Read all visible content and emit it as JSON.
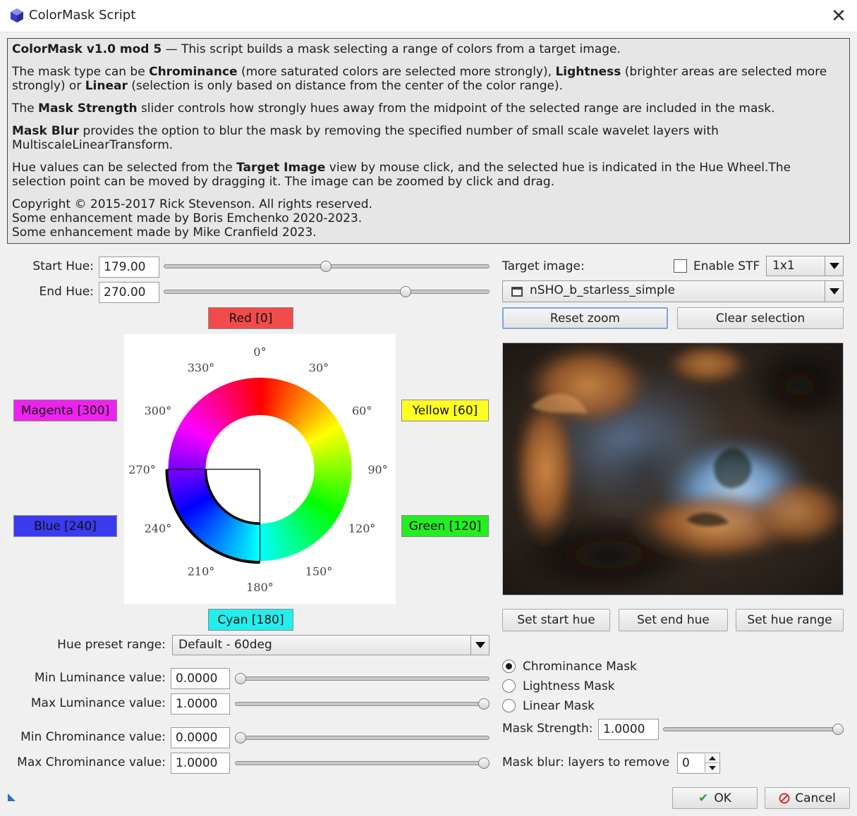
{
  "window": {
    "title": "ColorMask Script",
    "close_glyph": "✕"
  },
  "info": {
    "line1_bold": "ColorMask v1.0 mod 5",
    "line1_rest": " — This script builds a mask selecting a range of colors from a target image.",
    "p2_a": "The mask type can be ",
    "p2_b": "Chrominance",
    "p2_c": " (more saturated colors are selected more strongly), ",
    "p2_d": "Lightness",
    "p2_e": " (brighter areas are selected more strongly) or ",
    "p2_f": "Linear",
    "p2_g": " (selection is only based on distance from the center of the color range).",
    "p3_a": "The ",
    "p3_b": "Mask Strength",
    "p3_c": " slider controls how strongly hues away from the midpoint of the selected range are included in the mask.",
    "p4_b": "Mask Blur",
    "p4_c": " provides the option to blur the mask by removing the specified number of small scale wavelet layers with MultiscaleLinearTransform.",
    "p5_a": "Hue values can be selected from the ",
    "p5_b": "Target Image",
    "p5_c": " view by mouse click, and the selected hue is indicated in the Hue Wheel.The selection point can be moved by dragging it. The image can be zoomed by click and drag.",
    "copy1": "Copyright © 2015-2017 Rick Stevenson. All rights reserved.",
    "copy2": "Some enhancement made by Boris Emchenko 2020-2023.",
    "copy3": "Some enhancement made by Mike Cranfield 2023."
  },
  "hue": {
    "start_label": "Start Hue:",
    "start_value": "179.00",
    "start_fraction": 0.497,
    "end_label": "End Hue:",
    "end_value": "270.00",
    "end_fraction": 0.75
  },
  "hue_buttons": {
    "red": {
      "label": "Red [0]",
      "color": "#f24b4b"
    },
    "yellow": {
      "label": "Yellow [60]",
      "color": "#ffff22"
    },
    "green": {
      "label": "Green [120]",
      "color": "#22ee22"
    },
    "cyan": {
      "label": "Cyan [180]",
      "color": "#22eeee"
    },
    "blue": {
      "label": "Blue [240]",
      "color": "#3a3aee"
    },
    "magenta": {
      "label": "Magenta [300]",
      "color": "#ee22ee"
    }
  },
  "wheel": {
    "ticks": [
      "0°",
      "30°",
      "60°",
      "90°",
      "120°",
      "150°",
      "180°",
      "210°",
      "240°",
      "270°",
      "300°",
      "330°"
    ],
    "selection_start_deg": 180,
    "selection_end_deg": 270
  },
  "preset": {
    "label": "Hue preset range:",
    "value": "Default - 60deg"
  },
  "luminance": {
    "min_label": "Min Luminance value:",
    "min_value": "0.0000",
    "min_fraction": 0.0,
    "max_label": "Max Luminance value:",
    "max_value": "1.0000",
    "max_fraction": 1.0
  },
  "chrominance": {
    "min_label": "Min Chrominance value:",
    "min_value": "0.0000",
    "min_fraction": 0.0,
    "max_label": "Max Chrominance value:",
    "max_value": "1.0000",
    "max_fraction": 1.0
  },
  "target": {
    "label": "Target image:",
    "enable_stf_label": "Enable STF",
    "enable_stf_checked": false,
    "zoom_value": "1x1",
    "image_name": "nSHO_b_starless_simple",
    "reset_zoom": "Reset zoom",
    "clear_selection": "Clear selection",
    "set_start_hue": "Set start hue",
    "set_end_hue": "Set end hue",
    "set_hue_range": "Set hue range"
  },
  "mask_type": {
    "options": [
      "Chrominance Mask",
      "Lightness Mask",
      "Linear Mask"
    ],
    "selected_index": 0
  },
  "mask_strength": {
    "label": "Mask Strength:",
    "value": "1.0000",
    "fraction": 1.0
  },
  "mask_blur": {
    "label": "Mask blur: layers to remove",
    "value": "0"
  },
  "footer": {
    "ok": "OK",
    "cancel": "Cancel"
  }
}
